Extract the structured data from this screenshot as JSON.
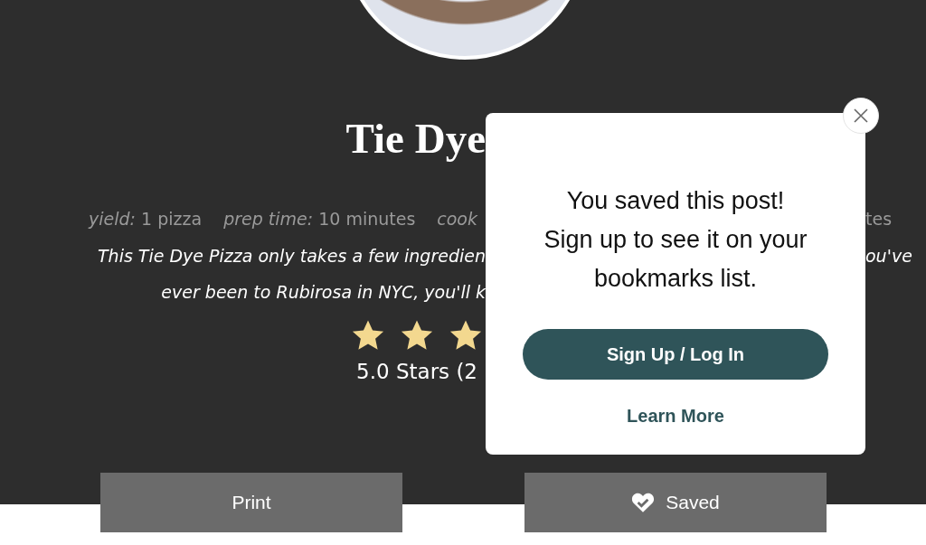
{
  "recipe": {
    "title": "Tie Dye",
    "meta": [
      {
        "label": "yield:",
        "value": "1 pizza"
      },
      {
        "label": "prep time:",
        "value": "10 minutes"
      },
      {
        "label": "cook"
      }
    ],
    "meta_right": "tes",
    "description_lines": [
      {
        "left": "This Tie Dye Pizza only takes a few ingredien",
        "right": "ou've"
      },
      {
        "left": "ever been to Rubirosa in NYC, you'll k"
      }
    ],
    "stars": 3,
    "rating": "5.0 Stars (2"
  },
  "popup": {
    "message": [
      "You saved this post!",
      "Sign up to see it on your bookmarks list."
    ],
    "primary_button": "Sign Up / Log In",
    "link": "Learn More"
  },
  "actions": [
    {
      "kind": "print",
      "label": "Print"
    },
    {
      "kind": "save",
      "label": "Saved",
      "saved": true
    }
  ]
}
